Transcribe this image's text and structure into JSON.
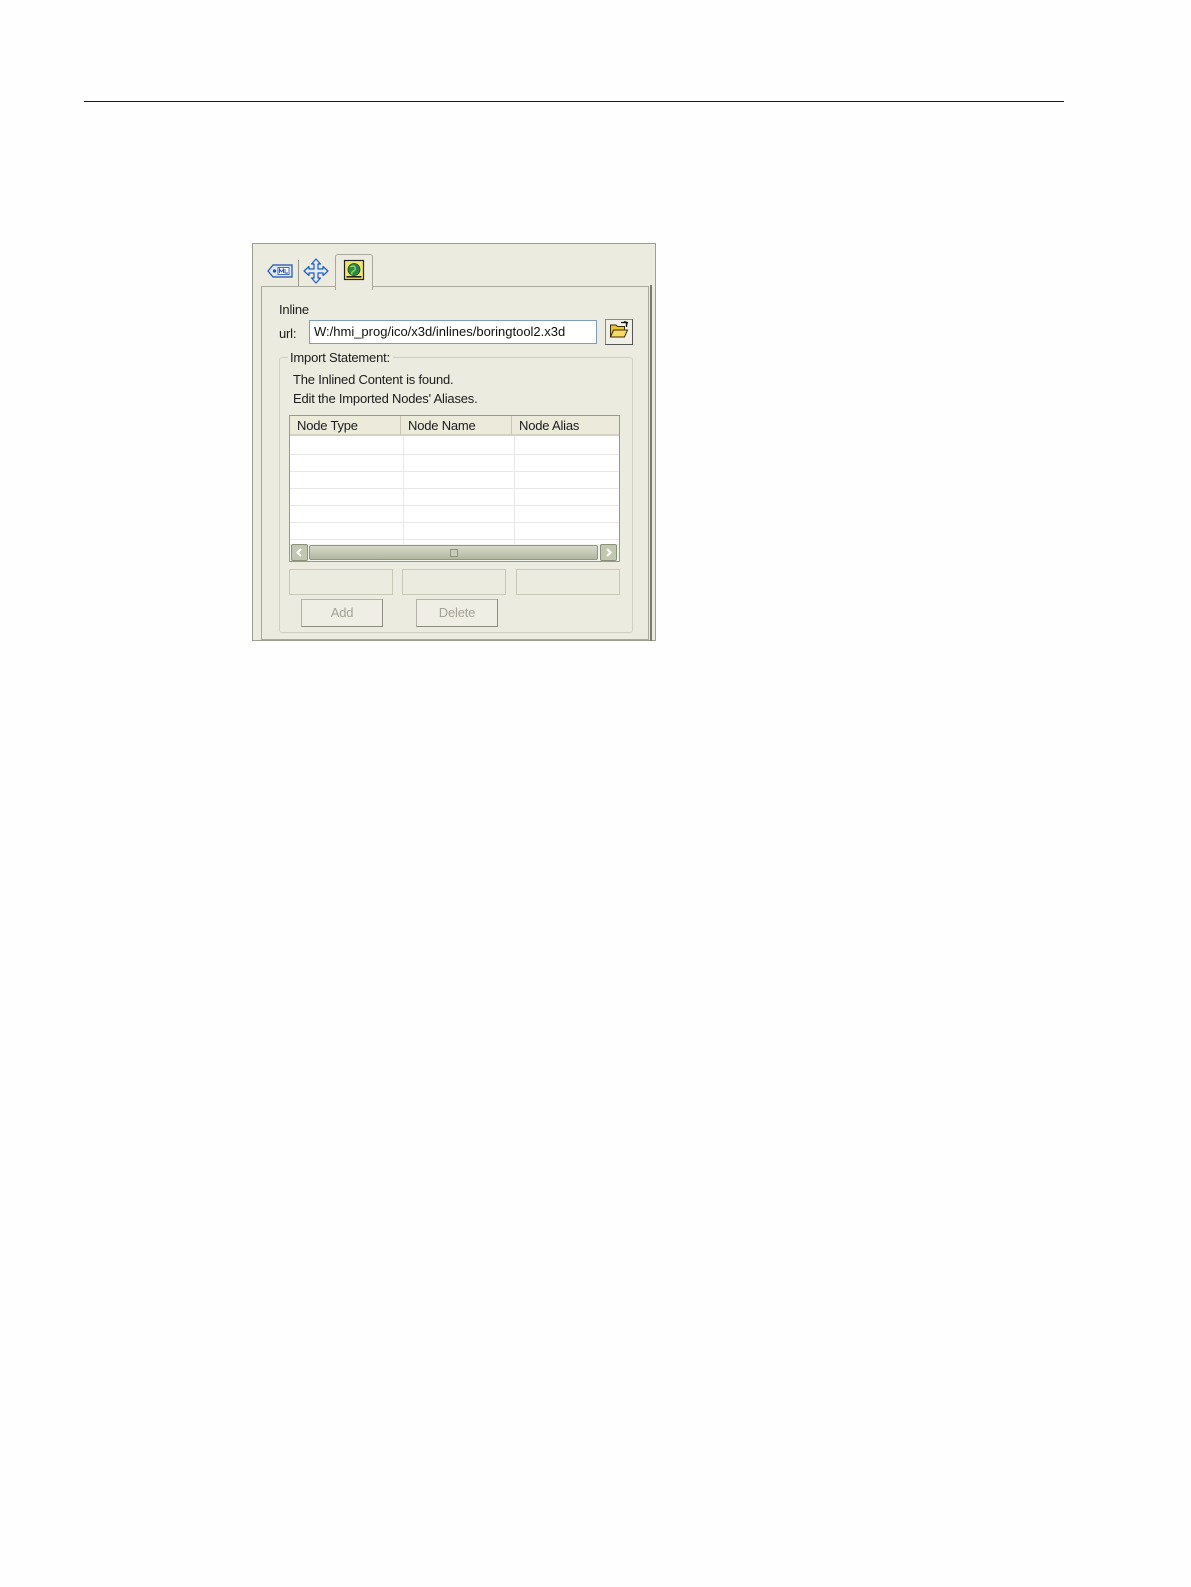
{
  "inline": {
    "section_label": "Inline",
    "url_label": "url:",
    "url_value": "W:/hmi_prog/ico/x3d/inlines/boringtool2.x3d"
  },
  "import_statement": {
    "title": "Import Statement:",
    "status_line1": "The Inlined Content is found.",
    "status_line2": "Edit the Imported Nodes' Aliases."
  },
  "table": {
    "columns": [
      "Node Type",
      "Node Name",
      "Node Alias"
    ],
    "rows": []
  },
  "buttons": {
    "add": "Add",
    "delete": "Delete",
    "add_enabled": false,
    "delete_enabled": false
  },
  "tabs": [
    {
      "icon": "tag-icon",
      "active": false
    },
    {
      "icon": "move-arrows-icon",
      "active": false
    },
    {
      "icon": "inline-globe-icon",
      "active": true
    }
  ]
}
